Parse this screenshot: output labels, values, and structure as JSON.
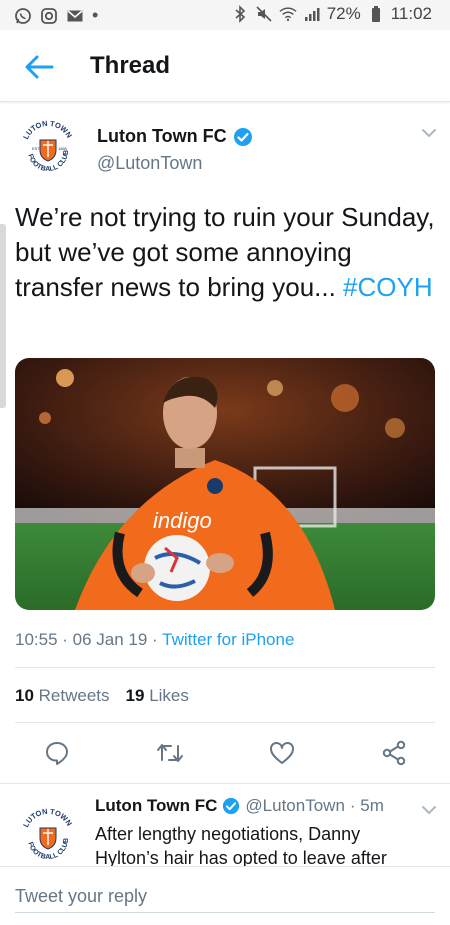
{
  "status_bar": {
    "battery": "72%",
    "time": "11:02"
  },
  "header": {
    "title": "Thread"
  },
  "tweet": {
    "author_name": "Luton Town FC",
    "author_handle": "@LutonTown",
    "text": "We’re not trying to ruin your Sunday, but we’ve got some annoying transfer news to bring you... ",
    "hashtag": "#COYH",
    "timestamp": "10:55 · 06 Jan 19 · ",
    "source": "Twitter for iPhone",
    "retweets_count": "10",
    "retweets_label": "Retweets",
    "likes_count": "19",
    "likes_label": "Likes"
  },
  "reply": {
    "author_name": "Luton Town FC",
    "author_handle": "@LutonTown",
    "time": "· 5m",
    "text": "After lengthy negotiations, Danny Hylton’s hair has opted to leave after"
  },
  "compose": {
    "placeholder": "Tweet your reply"
  },
  "colors": {
    "accent": "#1da1f2",
    "secondary_text": "#657786",
    "kit_orange": "#f26b1d"
  }
}
